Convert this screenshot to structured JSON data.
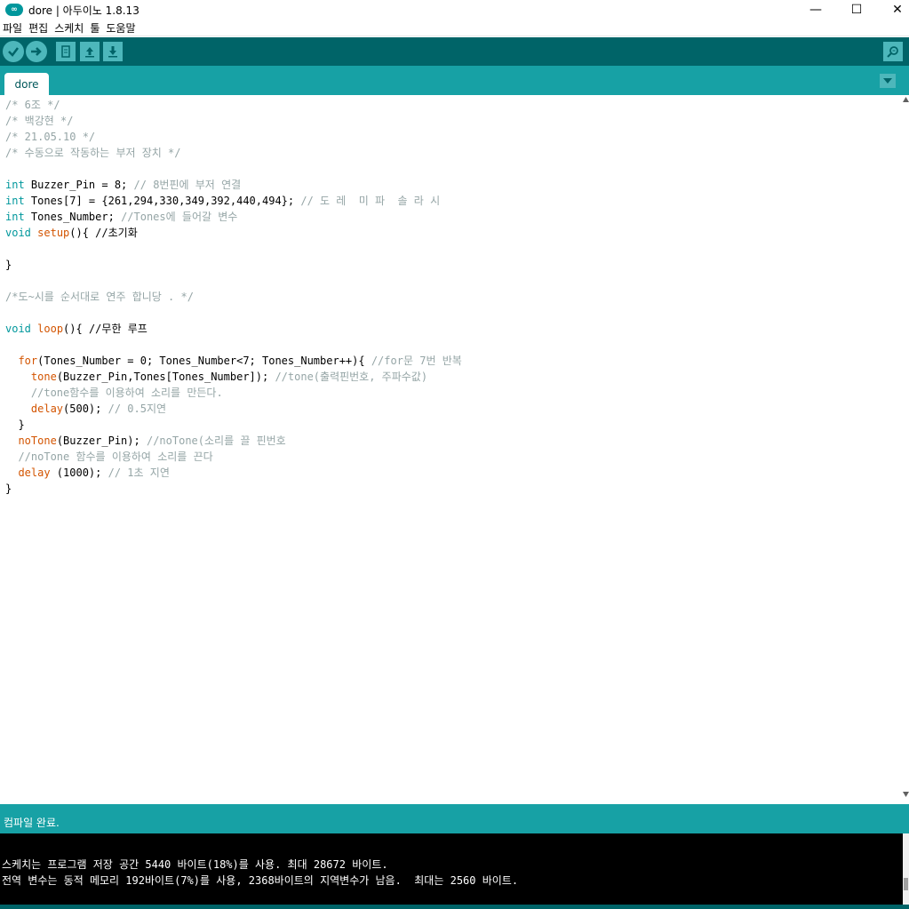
{
  "window": {
    "title": "dore | 아두이노 1.8.13",
    "logo_icon": "arduino-logo-icon",
    "controls": {
      "minimize": "—",
      "maximize": "☐",
      "close": "✕"
    }
  },
  "menu": [
    "파일",
    "편집",
    "스케치",
    "툴",
    "도움말"
  ],
  "toolbar": {
    "buttons": [
      "verify-icon",
      "upload-icon",
      "new-icon",
      "open-icon",
      "save-icon"
    ],
    "serial_monitor_icon": "serial-monitor-icon"
  },
  "tabs": [
    {
      "label": "dore"
    }
  ],
  "colors": {
    "toolbar_bg": "#006468",
    "tab_bar_bg": "#17a1a5",
    "keyword": "#00979c",
    "function": "#d35400",
    "comment": "#95a5a6"
  },
  "code": {
    "l1": "/* 6조 */",
    "l2": "/* 백강현 */",
    "l3": "/* 21.05.10 */",
    "l4": "/* 수동으로 작동하는 부저 장치 */",
    "l6_kw": "int",
    "l6_code": " Buzzer_Pin = 8; ",
    "l6_cm": "// 8번핀에 부저 연결",
    "l7_kw": "int",
    "l7_code": " Tones[7] = {261,294,330,349,392,440,494}; ",
    "l7_cm": "// 도 레  미 파  솔 라 시",
    "l8_kw": "int",
    "l8_code": " Tones_Number; ",
    "l8_cm": "//Tones에 들어갈 변수",
    "l9_kw": "void",
    "l9_sp": " ",
    "l9_fn": "setup",
    "l9_code": "(){ ",
    "l9_cm": "//초기화",
    "l11": "}",
    "l13": "/*도~시를 순서대로 연주 합니당 . */",
    "l15_kw": "void",
    "l15_sp": " ",
    "l15_fn": "loop",
    "l15_code": "(){ ",
    "l15_cm": "//무한 루프",
    "l17_ind": "  ",
    "l17_kw": "for",
    "l17_code": "(Tones_Number = 0; Tones_Number<7; Tones_Number++){ ",
    "l17_cm": "//for문 7번 반복",
    "l18_ind": "    ",
    "l18_fn": "tone",
    "l18_code": "(Buzzer_Pin,Tones[Tones_Number]); ",
    "l18_cm": "//tone(출력핀번호, 주파수값)",
    "l19": "    //tone함수를 이용하여 소리를 만든다.",
    "l20_ind": "    ",
    "l20_fn": "delay",
    "l20_code": "(500); ",
    "l20_cm": "// 0.5지연",
    "l21": "  }",
    "l22_ind": "  ",
    "l22_fn": "noTone",
    "l22_code": "(Buzzer_Pin); ",
    "l22_cm": "//noTone(소리를 끌 핀번호",
    "l23": "  //noTone 함수를 이용하여 소리를 끈다",
    "l24_ind": "  ",
    "l24_fn": "delay",
    "l24_code": " (1000); ",
    "l24_cm": "// 1초 지연",
    "l25": "}"
  },
  "console": {
    "status": "컴파일 완료.",
    "lines": [
      "스케치는 프로그램 저장 공간 5440 바이트(18%)를 사용. 최대 28672 바이트.",
      "전역 변수는 동적 메모리 192바이트(7%)를 사용, 2368바이트의 지역변수가 남음.  최대는 2560 바이트."
    ]
  }
}
